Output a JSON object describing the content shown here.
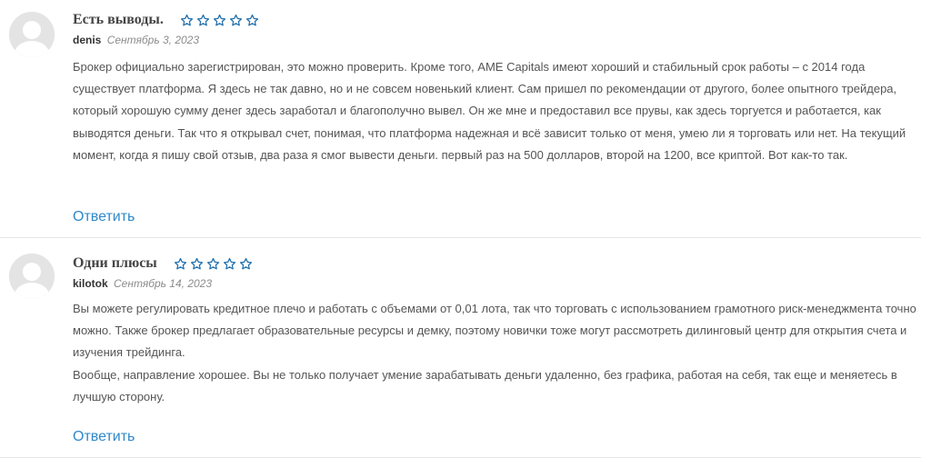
{
  "reviews": [
    {
      "title": "Есть выводы.",
      "rating": 0,
      "rating_max": 5,
      "author": "denis",
      "date": "Сентябрь 3, 2023",
      "paragraphs": [
        "Брокер официально зарегистрирован, это можно проверить. Кроме того, AME Capitals имеют хороший и стабильный срок работы – с 2014 года существует платформа. Я здесь не так давно, но и не совсем новенький клиент. Сам пришел по рекомендации от другого, более опытного трейдера, который хорошую сумму денег здесь заработал и благополучно вывел. Он же мне и предоставил все прувы, как здесь торгуется и работается, как выводятся деньги. Так что я открывал счет, понимая, что платформа надежная и всё зависит только от меня, умею ли я торговать или нет. На текущий момент, когда я пишу свой отзыв, два раза я смог вывести деньги. первый раз на 500 долларов, второй на 1200, все криптой. Вот как-то так."
      ],
      "reply_label": "Ответить"
    },
    {
      "title": "Одни плюсы",
      "rating": 0,
      "rating_max": 5,
      "author": "kilotok",
      "date": "Сентябрь 14, 2023",
      "paragraphs": [
        "Вы можете регулировать кредитное плечо и работать с объемами от 0,01 лота, так что торговать с использованием грамотного риск-менеджмента точно можно. Также брокер предлагает образовательные ресурсы и демку, поэтому новички тоже могут рассмотреть дилинговый центр для открытия счета и изучения трейдинга.",
        "Вообще, направление хорошее. Вы не только получает умение зарабатывать деньги удаленно, без графика, работая на себя, так еще и меняетесь в лучшую сторону."
      ],
      "reply_label": "Ответить"
    }
  ],
  "icons": {
    "avatar": "default-user-avatar-icon",
    "star": "star-outline-icon"
  },
  "colors": {
    "star": "#1f6fae",
    "reply_link": "#2e88c9",
    "avatar_bg": "#e4e4e4",
    "divider": "#e6e6e6"
  }
}
